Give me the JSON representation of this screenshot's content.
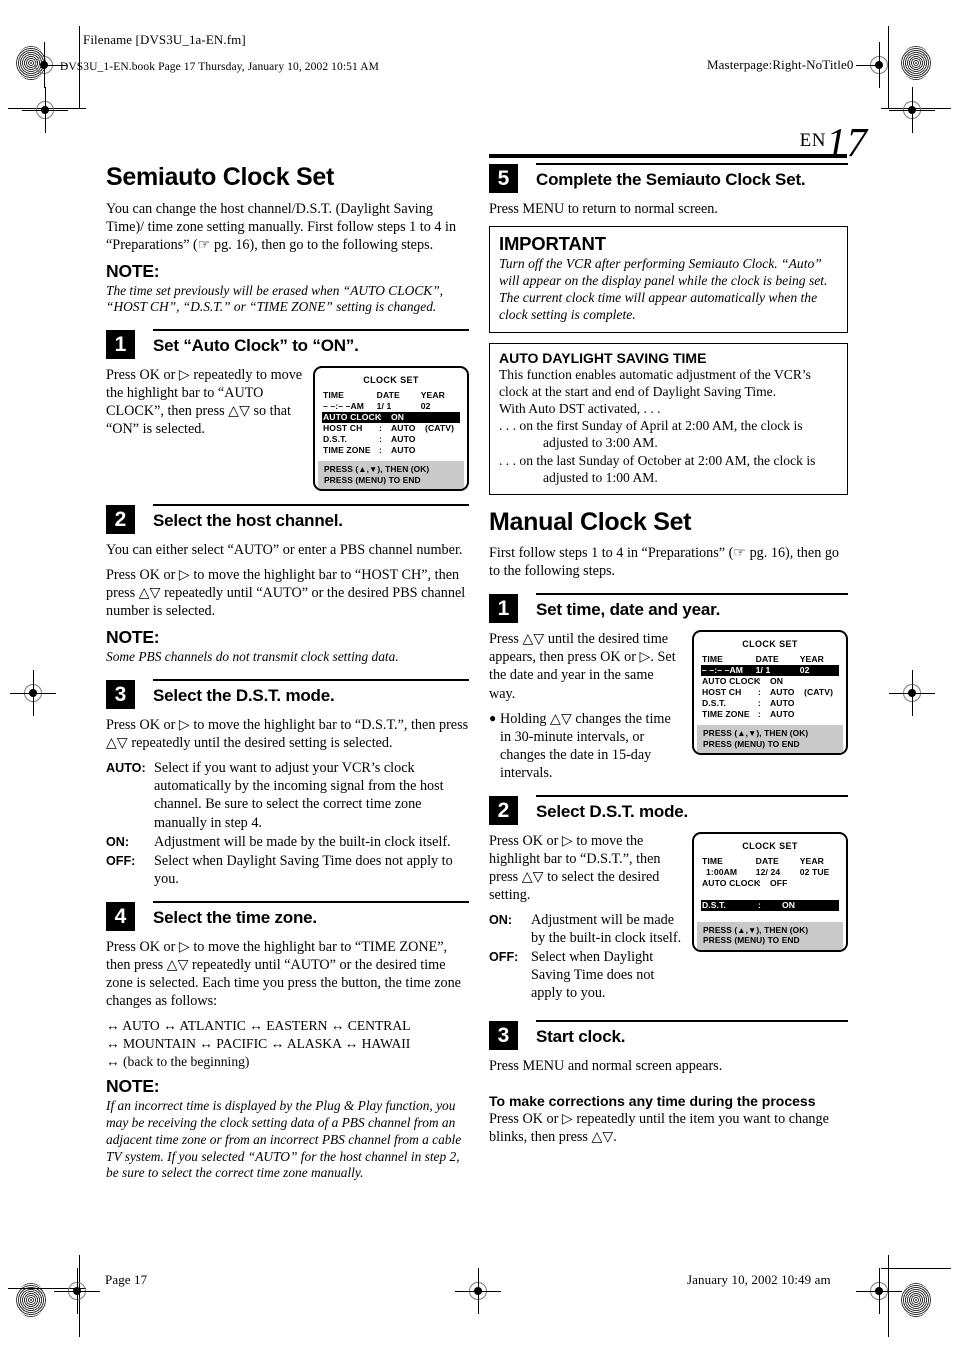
{
  "printmarks": {
    "filename_label": "Filename [DVS3U_1a-EN.fm]",
    "bookline": "DVS3U_1-EN.book  Page 17  Thursday, January 10, 2002  10:51 AM",
    "masterpage": "Masterpage:Right-NoTitle0",
    "footer_page": "Page 17",
    "footer_date": "January 10, 2002 10:49 am"
  },
  "header": {
    "lang_code": "EN",
    "page_number": "17"
  },
  "left_column": {
    "section_title": "Semiauto Clock Set",
    "intro": "You can change the host channel/D.S.T. (Daylight Saving Time)/ time zone setting manually. First follow steps 1 to 4 in “Preparations” (☞ pg. 16), then go to the following steps.",
    "note_label": "NOTE:",
    "note_text": "The time set previously will be erased when “AUTO CLOCK”, “HOST CH”, “D.S.T.” or “TIME ZONE” setting is changed.",
    "step1": {
      "number": "1",
      "title": "Set “Auto Clock” to “ON”.",
      "text": "Press OK or ▷ repeatedly to move the highlight bar to “AUTO CLOCK”, then press △▽ so that “ON” is selected."
    },
    "step2": {
      "number": "2",
      "title": "Select the host channel.",
      "text1": "You can either select “AUTO” or enter a PBS channel number.",
      "text2": "Press OK or ▷ to move the highlight bar to “HOST CH”, then press △▽ repeatedly until “AUTO” or the desired PBS channel number is selected.",
      "note_label": "NOTE:",
      "note_text": "Some PBS channels do not transmit clock setting data."
    },
    "step3": {
      "number": "3",
      "title": "Select the D.S.T. mode.",
      "text": "Press OK or ▷ to move the highlight bar to “D.S.T.”, then press △▽ repeatedly until the desired setting is selected.",
      "defs": [
        {
          "term": "AUTO:",
          "desc": "Select if you want to adjust your VCR’s clock automatically by the incoming signal from the host channel. Be sure to select the correct time zone manually in step 4."
        },
        {
          "term": "ON:",
          "desc": "Adjustment will be made by the built-in clock itself."
        },
        {
          "term": "OFF:",
          "desc": "Select when Daylight Saving Time does not apply to you."
        }
      ]
    },
    "step4": {
      "number": "4",
      "title": "Select the time zone.",
      "text": "Press OK or ▷ to move the highlight bar to “TIME ZONE”, then press △▽ repeatedly until “AUTO” or the desired time zone is selected. Each time you press the button, the time zone changes as follows:",
      "zones_line1": "↔ AUTO ↔ ATLANTIC ↔ EASTERN ↔ CENTRAL",
      "zones_line2": "↔ MOUNTAIN ↔ PACIFIC ↔ ALASKA ↔ HAWAII",
      "zones_line3": "↔ (back to the beginning)",
      "note_label": "NOTE:",
      "note_text": "If an incorrect time is displayed by the Plug & Play function, you may be receiving the clock setting data of a PBS channel from an adjacent time zone or from an incorrect PBS channel from a cable TV system. If you selected “AUTO” for the host channel in step 2, be sure to select the correct time zone manually."
    }
  },
  "right_column": {
    "step5": {
      "number": "5",
      "title": "Complete the Semiauto Clock Set.",
      "text": "Press MENU to return to normal screen."
    },
    "important_box": {
      "heading": "IMPORTANT",
      "text": "Turn off the VCR after performing Semiauto Clock. “Auto” will appear on the display panel while the clock is being set. The current clock time will appear automatically when the clock setting is complete."
    },
    "dst_box": {
      "heading": "AUTO DAYLIGHT SAVING TIME",
      "line1": "This function enables automatic adjustment of the VCR’s clock at the start and end of Daylight Saving Time.",
      "line2": "With Auto DST activated, . . .",
      "bullet1": ". . . on the first Sunday of April at 2:00 AM, the clock is",
      "bullet1_cont": "adjusted to 3:00 AM.",
      "bullet2": ". . . on the last Sunday of October at 2:00 AM, the clock is",
      "bullet2_cont": "adjusted to 1:00 AM."
    },
    "section_title": "Manual Clock Set",
    "intro": "First follow steps 1 to 4 in “Preparations” (☞ pg. 16), then go to the following steps.",
    "step1": {
      "number": "1",
      "title": "Set time, date and year.",
      "text": "Press △▽ until the desired time appears, then press OK or ▷. Set the date and year in the same way.",
      "bullet": "Holding △▽ changes the time in 30-minute intervals, or changes the date in 15-day intervals."
    },
    "step2": {
      "number": "2",
      "title": "Select D.S.T. mode.",
      "text": "Press OK or ▷ to move the highlight bar to “D.S.T.”, then press △▽ to select the desired setting.",
      "defs": [
        {
          "term": "ON:",
          "desc": "Adjustment will be made by the built-in clock itself."
        },
        {
          "term": "OFF:",
          "desc": "Select when Daylight Saving Time does not apply to you."
        }
      ]
    },
    "step3": {
      "number": "3",
      "title": "Start clock.",
      "text": "Press MENU and normal screen appears."
    },
    "corrections": {
      "heading": "To make corrections any time during the process",
      "text": "Press OK or ▷ repeatedly until the item you want to change blinks, then press △▽."
    }
  },
  "osd_screens": {
    "semiauto_step1": {
      "title": "CLOCK SET",
      "head": {
        "time": "TIME",
        "date": "DATE",
        "year": "YEAR"
      },
      "values": {
        "time": "– –:– –AM",
        "date": "1/ 1",
        "year": "02"
      },
      "rows": [
        {
          "label": "AUTO CLOCK",
          "sep": ": ",
          "value": "ON",
          "extra": "",
          "highlight": true
        },
        {
          "label": "HOST CH",
          "sep": ": ",
          "value": "AUTO",
          "extra": "(CATV)",
          "highlight": false
        },
        {
          "label": "D.S.T.",
          "sep": ": ",
          "value": "AUTO",
          "extra": "",
          "highlight": false
        },
        {
          "label": "TIME ZONE",
          "sep": ": ",
          "value": "AUTO",
          "extra": "",
          "highlight": false
        }
      ],
      "footer1": "PRESS (▲,▼), THEN (OK)",
      "footer2": "PRESS (MENU) TO END"
    },
    "manual_step1": {
      "title": "CLOCK SET",
      "head": {
        "time": "TIME",
        "date": "DATE",
        "year": "YEAR"
      },
      "values": {
        "time": "– –:– –AM",
        "date": "1/ 1",
        "year": "02"
      },
      "value_row_highlight": true,
      "rows": [
        {
          "label": "AUTO CLOCK",
          "sep": ": ",
          "value": "ON",
          "extra": "",
          "highlight": false
        },
        {
          "label": "HOST CH",
          "sep": ": ",
          "value": "AUTO",
          "extra": "(CATV)",
          "highlight": false
        },
        {
          "label": "D.S.T.",
          "sep": ": ",
          "value": "AUTO",
          "extra": "",
          "highlight": false
        },
        {
          "label": "TIME ZONE",
          "sep": ": ",
          "value": "AUTO",
          "extra": "",
          "highlight": false
        }
      ],
      "footer1": "PRESS (▲,▼), THEN (OK)",
      "footer2": "PRESS (MENU) TO END"
    },
    "manual_step2": {
      "title": "CLOCK SET",
      "head": {
        "time": "TIME",
        "date": "DATE",
        "year": "YEAR"
      },
      "values": {
        "time": "1:00AM",
        "date": "12/ 24",
        "year": "02 TUE"
      },
      "rows": [
        {
          "label": "AUTO CLOCK",
          "sep": ": ",
          "value": "OFF",
          "extra": "",
          "highlight": false
        },
        {
          "label": "D.S.T.",
          "sep": ": ",
          "value": "ON",
          "extra": "",
          "highlight": true
        }
      ],
      "footer1": "PRESS (▲,▼), THEN (OK)",
      "footer2": "PRESS (MENU) TO END"
    }
  }
}
